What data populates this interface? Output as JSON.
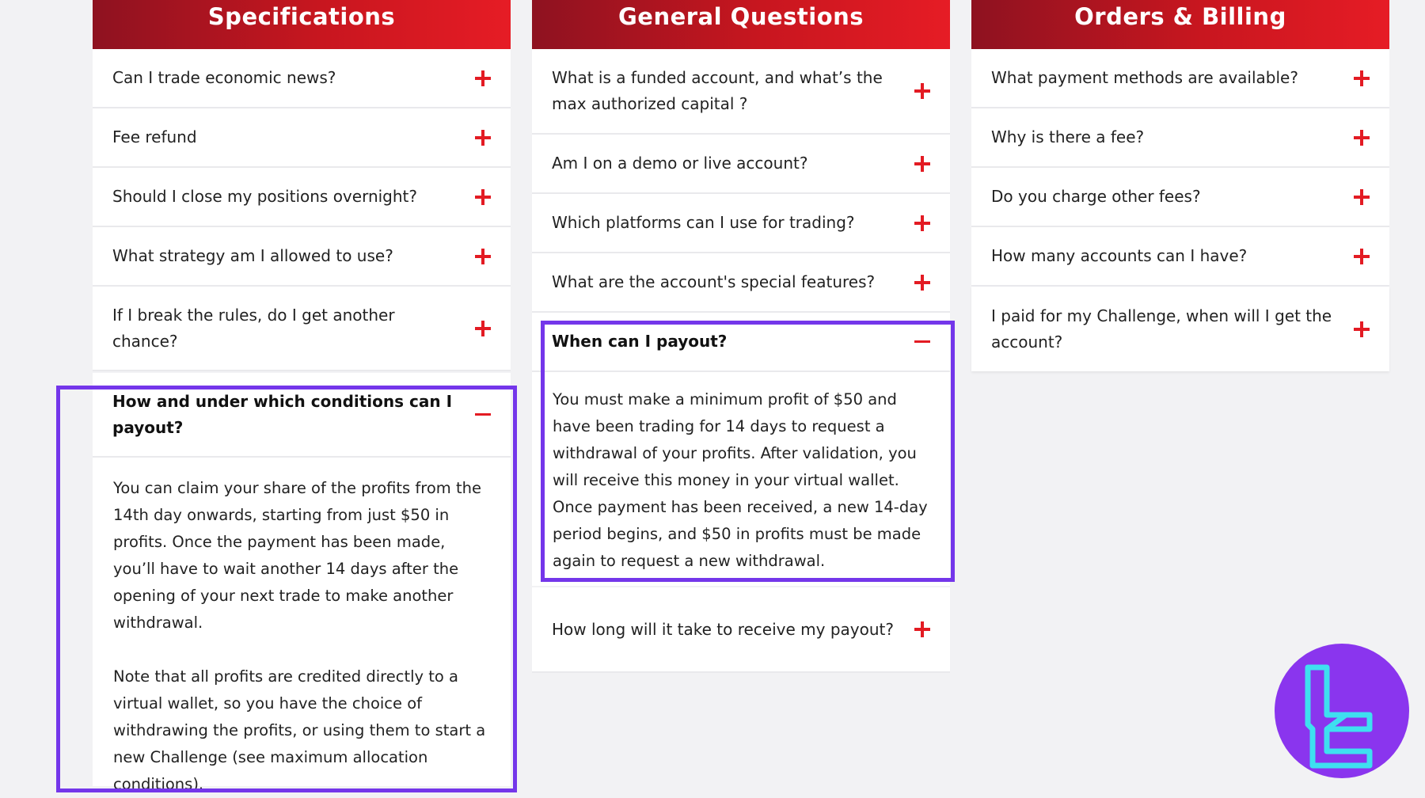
{
  "columns": [
    {
      "title": "Specifications",
      "items": [
        {
          "q": "Can I trade economic news?"
        },
        {
          "q": "Fee refund"
        },
        {
          "q": "Should I close my positions overnight?"
        },
        {
          "q": "What strategy am I allowed to use?"
        },
        {
          "q": "If I break the rules, do I get another chance?"
        },
        {
          "q": "How and under which conditions can I payout?"
        }
      ],
      "open_answer": [
        "You can claim your share of the profits from the 14th day onwards, starting from just $50 in profits. Once the payment has been made, you’ll have to wait another 14 days after the opening of your next trade to make another withdrawal.",
        "Note that all profits are credited directly to a virtual wallet, so you have the choice of withdrawing the profits, or using them to start a new Challenge (see maximum allocation conditions)."
      ]
    },
    {
      "title": "General Questions",
      "items": [
        {
          "q": "What is a funded account, and what’s the max authorized capital ?"
        },
        {
          "q": "Am I on a demo or live account?"
        },
        {
          "q": "Which platforms can I use for trading?"
        },
        {
          "q": "What are the account's special features?"
        },
        {
          "q": "When can I payout?"
        },
        {
          "q": "How long will it take to receive my payout?"
        }
      ],
      "open_answer": [
        "You must make a minimum profit of $50 and have been trading for 14 days to request a withdrawal of your profits. After validation, you will receive this money in your virtual wallet. Once payment has been received, a new 14-day period begins, and $50 in profits must be made again to request a new withdrawal."
      ]
    },
    {
      "title": "Orders & Billing",
      "items": [
        {
          "q": "What payment methods are available?"
        },
        {
          "q": "Why is there a fee?"
        },
        {
          "q": "Do you charge other fees?"
        },
        {
          "q": "How many accounts can I have?"
        },
        {
          "q": "I paid for my Challenge, when will I get the account?"
        }
      ]
    }
  ],
  "colors": {
    "accent": "#e31b23",
    "header_dark": "#8e1220",
    "highlight": "#7436ea",
    "logo_bg": "#8a35ee",
    "logo_mark": "#3ee0f0"
  }
}
